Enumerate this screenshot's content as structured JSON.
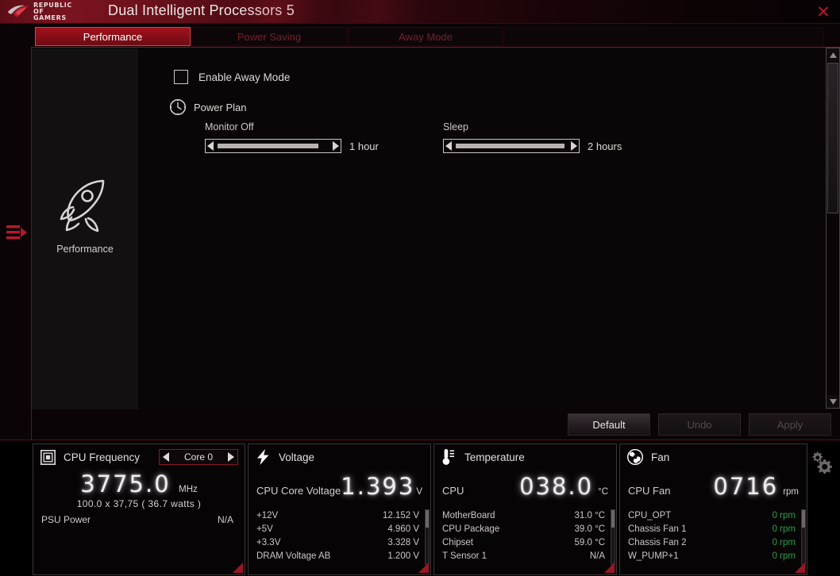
{
  "titlebar": {
    "logo_line1": "REPUBLIC OF",
    "logo_line2": "GAMERS",
    "title": "Dual Intelligent Processors 5",
    "close_label": "✕"
  },
  "tabs": [
    {
      "label": "Performance",
      "active": true
    },
    {
      "label": "Power Saving",
      "active": false
    },
    {
      "label": "Away Mode",
      "active": false
    }
  ],
  "sidebar": {
    "menu_toggle_name": "expand-menu",
    "rail_items": [
      {
        "label": "Performance",
        "icon": "rocket-icon"
      }
    ]
  },
  "pane": {
    "away_mode": {
      "label": "Enable Away Mode",
      "checked": false
    },
    "power_plan": {
      "label": "Power Plan",
      "icon": "clock-icon"
    },
    "sliders": [
      {
        "caption": "Monitor Off",
        "value": "1 hour"
      },
      {
        "caption": "Sleep",
        "value": "2 hours"
      }
    ]
  },
  "actions": {
    "default": {
      "label": "Default",
      "enabled": true
    },
    "undo": {
      "label": "Undo",
      "enabled": false
    },
    "apply": {
      "label": "Apply",
      "enabled": false
    }
  },
  "monitor": {
    "cpu_frequency": {
      "title": "CPU Frequency",
      "icon": "cpu-chip-icon",
      "core_selector": "Core 0",
      "big_value": "3775.0",
      "big_unit": "MHz",
      "sub": "100.0  x  37,75 ( 36.7   watts )",
      "psu_label": "PSU Power",
      "psu_value": "N/A"
    },
    "voltage": {
      "title": "Voltage",
      "icon": "lightning-icon",
      "main_label": "CPU Core Voltage",
      "big_value": "1.393",
      "big_unit": "V",
      "rows": [
        {
          "name": "+12V",
          "value": "12.152  V"
        },
        {
          "name": "+5V",
          "value": "4.960  V"
        },
        {
          "name": "+3.3V",
          "value": "3.328  V"
        },
        {
          "name": "DRAM Voltage AB",
          "value": "1.200  V"
        }
      ]
    },
    "temperature": {
      "title": "Temperature",
      "icon": "thermometer-icon",
      "main_label": "CPU",
      "big_value": "038.0",
      "big_unit": "°C",
      "rows": [
        {
          "name": "MotherBoard",
          "value": "31.0 °C"
        },
        {
          "name": "CPU Package",
          "value": "39.0 °C"
        },
        {
          "name": "Chipset",
          "value": "59.0 °C"
        },
        {
          "name": "T Sensor 1",
          "value": "N/A"
        }
      ]
    },
    "fan": {
      "title": "Fan",
      "icon": "fan-icon",
      "main_label": "CPU Fan",
      "big_value": "0716",
      "big_unit": "rpm",
      "rows": [
        {
          "name": "CPU_OPT",
          "value": "0  rpm"
        },
        {
          "name": "Chassis Fan 1",
          "value": "0  rpm"
        },
        {
          "name": "Chassis Fan 2",
          "value": "0  rpm"
        },
        {
          "name": "W_PUMP+1",
          "value": "0  rpm"
        }
      ]
    },
    "settings_icon": "gear-icon"
  },
  "colors": {
    "accent_red": "#a3101c",
    "tab_inactive_text": "#742028",
    "fan_value_green": "#2f9c4a",
    "corner_triangle": "#991724"
  }
}
